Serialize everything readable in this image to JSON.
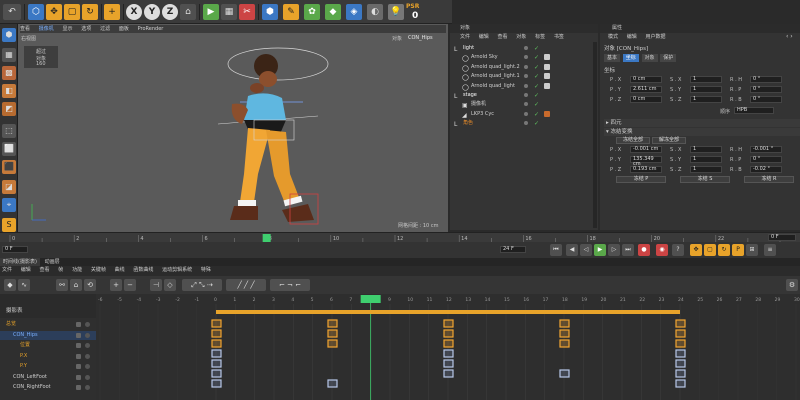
{
  "toolbar": {
    "undo_icon": "undo-icon",
    "tools": [
      "↶",
      "⬡",
      "✥",
      "▢",
      "↻",
      "+",
      "X",
      "Y",
      "Z",
      "⌂",
      "▶",
      "▦",
      "✂",
      "⬢",
      "⚙",
      "✿",
      "◆",
      "◈",
      "◐",
      "⬜",
      "⬚",
      "⬛",
      "💡"
    ],
    "psr_label": "PSR",
    "psr_value": "0"
  },
  "viewport": {
    "menu": [
      "查看",
      "摄像机",
      "显示",
      "选项",
      "过滤",
      "面板",
      "ProRender"
    ],
    "active_menu_index": 1,
    "view_label": "右视图",
    "camera_label": "对象",
    "camera_object": "CON_Hips",
    "hud": {
      "l1": "超过",
      "l2": "对象",
      "l3": "160"
    },
    "grid_label": "网格间距 : 10 cm"
  },
  "object_manager": {
    "menu": [
      "文件",
      "编辑",
      "查看",
      "对象",
      "标签",
      "书签"
    ],
    "items": [
      {
        "name": "light",
        "indent": 0,
        "type": "null",
        "color": "#ffffff"
      },
      {
        "name": "Arnold Sky",
        "indent": 1,
        "type": "light",
        "color": "#d0d0d0"
      },
      {
        "name": "Arnold quad_light.2",
        "indent": 1,
        "type": "light",
        "color": "#d0d0d0"
      },
      {
        "name": "Arnold quad_light.1",
        "indent": 1,
        "type": "light",
        "color": "#d0d0d0"
      },
      {
        "name": "Arnold quad_light",
        "indent": 1,
        "type": "light",
        "color": "#d0d0d0"
      },
      {
        "name": "stage",
        "indent": 0,
        "type": "null",
        "color": "#ffffff"
      },
      {
        "name": "摄像机",
        "indent": 1,
        "type": "camera",
        "color": "#d0d0d0"
      },
      {
        "name": "LKP3 Cyc",
        "indent": 1,
        "type": "cyc",
        "color": "#d0d0d0"
      },
      {
        "name": "角色",
        "indent": 0,
        "type": "null",
        "color": "#e48a2a"
      }
    ]
  },
  "attributes": {
    "header": "属性",
    "menu": [
      "模式",
      "编辑",
      "用户数据"
    ],
    "object_title": "对象 [CON_Hips]",
    "tabs": [
      "基本",
      "坐标",
      "对象",
      "保护"
    ],
    "active_tab_index": 1,
    "section_coords": "坐标",
    "coords": [
      {
        "p_label": "P . X",
        "p_value": "0 cm",
        "s_label": "S . X",
        "s_value": "1",
        "r_label": "R . H",
        "r_value": "0 °"
      },
      {
        "p_label": "P . Y",
        "p_value": "2.611 cm",
        "s_label": "S . Y",
        "s_value": "1",
        "r_label": "R . P",
        "r_value": "0 °"
      },
      {
        "p_label": "P . Z",
        "p_value": "0 cm",
        "s_label": "S . Z",
        "s_value": "1",
        "r_label": "R . B",
        "r_value": "0 °"
      }
    ],
    "order_label": "顺序",
    "order_value": "HPB",
    "section_quat": "▸ 四元",
    "section_freeze": "▾ 冻结变换",
    "freeze_all": "冻结全部",
    "unfreeze_all": "解冻全部",
    "freeze_rows": [
      {
        "p_label": "P . X",
        "p_value": "-0.001 cm",
        "s_label": "S . X",
        "s_value": "1",
        "r_label": "R . H",
        "r_value": "-0.001 °"
      },
      {
        "p_label": "P . Y",
        "p_value": "135.349 cm",
        "s_label": "S . Y",
        "s_value": "1",
        "r_label": "R . P",
        "r_value": "0 °"
      },
      {
        "p_label": "P . Z",
        "p_value": "0.193 cm",
        "s_label": "S . Z",
        "s_value": "1",
        "r_label": "R . B",
        "r_value": "-0.02 °"
      }
    ],
    "freeze_p": "冻结 P",
    "freeze_s": "冻结 S",
    "freeze_r": "冻结 R"
  },
  "timeline": {
    "ticks": [
      "0",
      "2",
      "4",
      "6",
      "8",
      "10",
      "12",
      "14",
      "16",
      "18",
      "20",
      "22",
      "24"
    ],
    "current_frame": "8",
    "left_field": "0 F",
    "mid_field": "24 F",
    "right_field": "0 F"
  },
  "dope_sheet": {
    "tabs": [
      "时间线(摄影表)",
      "动画层"
    ],
    "menu": [
      "文件",
      "编辑",
      "查看",
      "帧",
      "功能",
      "关键帧",
      "曲线",
      "函数曲线",
      "运动剪辑系统",
      "特殊"
    ],
    "header_label": "摄影表",
    "frame_numbers": [
      "-6",
      "-5",
      "-4",
      "-3",
      "-2",
      "-1",
      "0",
      "1",
      "2",
      "3",
      "4",
      "5",
      "6",
      "7",
      "8",
      "9",
      "10",
      "11",
      "12",
      "13",
      "14",
      "15",
      "16",
      "17",
      "18",
      "19",
      "20",
      "21",
      "22",
      "23",
      "24",
      "25",
      "26",
      "27",
      "28",
      "29",
      "30"
    ],
    "current_frame": "8",
    "tracks": [
      {
        "name": "总览",
        "indent": 0,
        "color": "#e8a32a"
      },
      {
        "name": "CON_Hips",
        "indent": 1,
        "color": "#7ab0ff"
      },
      {
        "name": "位置",
        "indent": 2,
        "color": "#e8a32a"
      },
      {
        "name": "P.X",
        "indent": 2,
        "color": "#e8a32a"
      },
      {
        "name": "P.Y",
        "indent": 2,
        "color": "#e8a32a"
      },
      {
        "name": "CON_LeftFoot",
        "indent": 1,
        "color": "#d0d0d0"
      },
      {
        "name": "CON_RightFoot",
        "indent": 1,
        "color": "#d0d0d0"
      }
    ]
  },
  "colors": {
    "accent": "#e8a32a",
    "select_blue": "#3b78c4",
    "key_orange": "#f2a531",
    "key_white": "#b7c7e8"
  }
}
